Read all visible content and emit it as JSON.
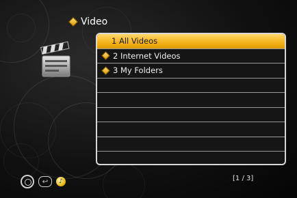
{
  "header": {
    "title": "Video",
    "title_icon": "folder-diamond-icon"
  },
  "left_icon": "clapperboard-icon",
  "menu": {
    "items": [
      {
        "label": "1 All Videos",
        "selected": true,
        "icon": "folder-diamond-icon"
      },
      {
        "label": "2 Internet Videos",
        "selected": false,
        "icon": "folder-diamond-icon"
      },
      {
        "label": "3 My Folders",
        "selected": false,
        "icon": "folder-diamond-icon"
      },
      {
        "label": "",
        "selected": false
      },
      {
        "label": "",
        "selected": false
      },
      {
        "label": "",
        "selected": false
      },
      {
        "label": "",
        "selected": false
      },
      {
        "label": "",
        "selected": false
      },
      {
        "label": "",
        "selected": false
      }
    ]
  },
  "footer": {
    "page_indicator": "[1 / 3]",
    "hint_icons": [
      "dpad-icon",
      "back-icon",
      "music-note-icon"
    ]
  },
  "colors": {
    "selection": "#f4b219",
    "border": "#d8d8d8",
    "background": "#000000"
  }
}
